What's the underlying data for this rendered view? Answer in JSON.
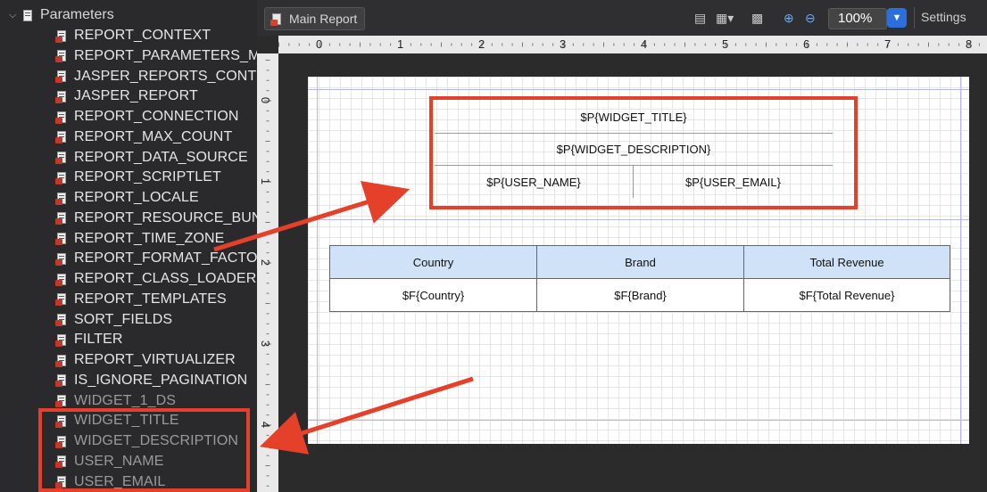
{
  "left_panel": {
    "header_label": "Parameters",
    "system_params": [
      "REPORT_CONTEXT",
      "REPORT_PARAMETERS_M",
      "JASPER_REPORTS_CONTI",
      "JASPER_REPORT",
      "REPORT_CONNECTION",
      "REPORT_MAX_COUNT",
      "REPORT_DATA_SOURCE",
      "REPORT_SCRIPTLET",
      "REPORT_LOCALE",
      "REPORT_RESOURCE_BUN",
      "REPORT_TIME_ZONE",
      "REPORT_FORMAT_FACTO",
      "REPORT_CLASS_LOADER",
      "REPORT_TEMPLATES",
      "SORT_FIELDS",
      "FILTER",
      "REPORT_VIRTUALIZER",
      "IS_IGNORE_PAGINATION"
    ],
    "user_params": [
      "WIDGET_1_DS",
      "WIDGET_TITLE",
      "WIDGET_DESCRIPTION",
      "USER_NAME",
      "USER_EMAIL"
    ]
  },
  "toolbar": {
    "tab_label": "Main Report",
    "zoom_value": "100%",
    "settings_label": "Settings"
  },
  "ruler": {
    "h_numbers": [
      "0",
      "1",
      "2",
      "3",
      "4",
      "5",
      "6",
      "7",
      "8"
    ],
    "v_numbers": [
      "0",
      "1",
      "2",
      "3",
      "4"
    ]
  },
  "report": {
    "title_field": "$P{WIDGET_TITLE}",
    "description_field": "$P{WIDGET_DESCRIPTION}",
    "user_name_field": "$P{USER_NAME}",
    "user_email_field": "$P{USER_EMAIL}",
    "table_headers": [
      "Country",
      "Brand",
      "Total Revenue"
    ],
    "table_fields": [
      "$F{Country}",
      "$F{Brand}",
      "$F{Total Revenue}"
    ]
  },
  "annotation_color": "#e5402a"
}
